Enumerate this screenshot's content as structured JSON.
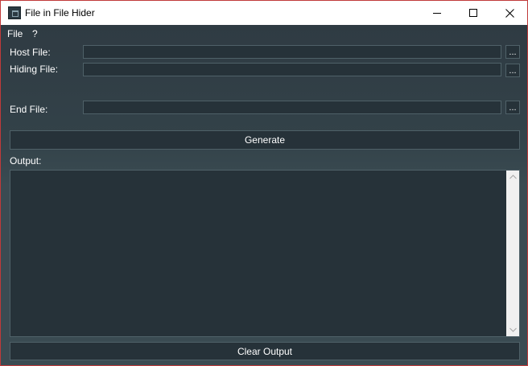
{
  "window": {
    "title": "File in File Hider"
  },
  "menu": {
    "file": "File",
    "help": "?"
  },
  "form": {
    "host_label": "Host File:",
    "host_value": "",
    "hiding_label": "Hiding File:",
    "hiding_value": "",
    "end_label": "End File:",
    "end_value": "",
    "browse_label": "..."
  },
  "actions": {
    "generate": "Generate",
    "clear_output": "Clear Output"
  },
  "output": {
    "label": "Output:",
    "text": ""
  },
  "icons": {
    "app": "app-window-icon",
    "minimize": "minimize-icon",
    "maximize": "maximize-icon",
    "close": "close-icon",
    "scroll_up": "chevron-up-icon",
    "scroll_down": "chevron-down-icon"
  },
  "colors": {
    "window_border": "#c03a3a",
    "background": "#2f3e46",
    "control_background": "#263239",
    "control_border": "#4f6168",
    "text": "#ffffff"
  }
}
